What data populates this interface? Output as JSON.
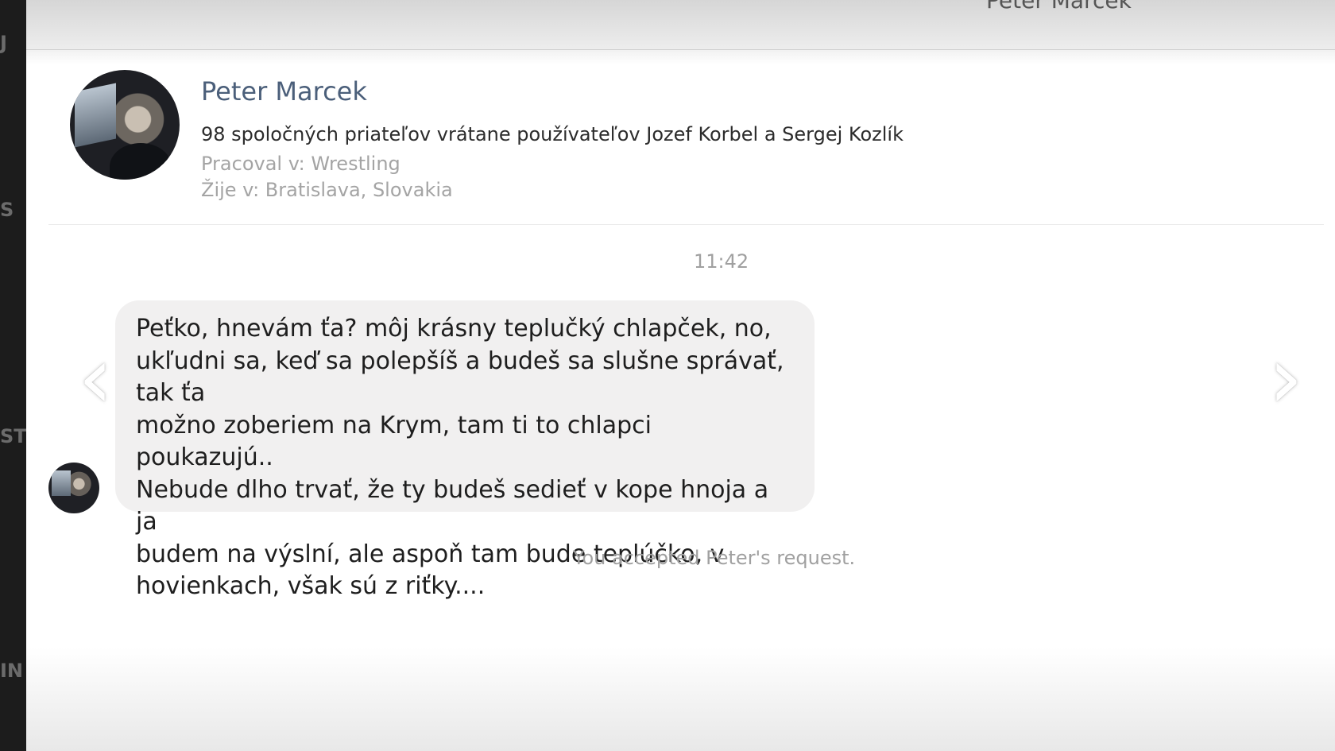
{
  "titlebar": {
    "name": "Peter Marcek"
  },
  "profile": {
    "name": "Peter Marcek",
    "mutual_friends": "98 spoločných priateľov vrátane používateľov Jozef Korbel a Sergej Kozlík",
    "work": "Pracoval v: Wrestling",
    "lives": "Žije v: Bratislava, Slovakia"
  },
  "conversation": {
    "timestamp": "11:42",
    "message": "Peťko, hnevám ťa? môj krásny teplučký chlapček, no,\nukľudni sa, keď sa polepšíš a budeš sa slušne správať, tak ťa\nmožno zoberiem na Krym, tam ti to chlapci poukazujú..\nNebude dlho trvať, že ty budeš sedieť v kope hnoja a ja\nbudem na výslní, ale aspoň tam bude teplúčko, v\nhovienkach, však sú z riťky....",
    "system_note": "You accepted Peter's request."
  },
  "nav": {
    "prev_icon": "‹",
    "next_icon": "›"
  },
  "left_strip": {
    "fragments": [
      "J",
      "S",
      "ST",
      "IN"
    ]
  }
}
